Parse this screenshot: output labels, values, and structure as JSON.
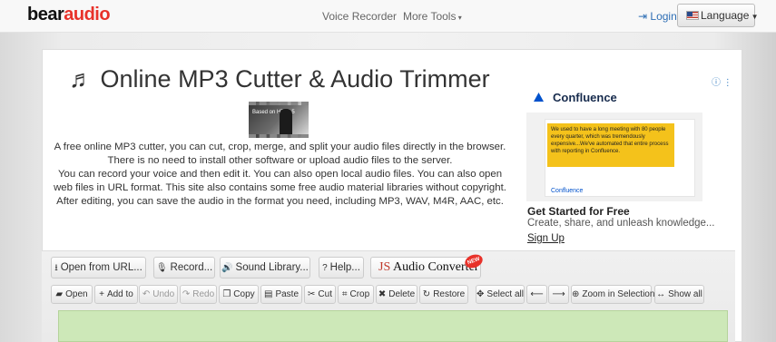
{
  "nav": {
    "logo_bear": "bear",
    "logo_audio": "audio",
    "voice_recorder": "Voice Recorder",
    "more_tools": "More Tools",
    "login": "Login",
    "language": "Language"
  },
  "main": {
    "title": "Online MP3 Cutter & Audio Trimmer",
    "thumbnail_text": "Based on HTML5",
    "description_1": "A free online MP3 cutter, you can cut, crop, merge, and split your audio files directly in the browser. There is no need to install other software or upload audio files to the server.",
    "description_2": "You can record your voice and then edit it. You can also open local audio files. You can also open web files in URL format. This site also contains some free audio material libraries without copyright. After editing, you can save the audio in the format you need, including MP3, WAV, M4R, AAC, etc."
  },
  "ad": {
    "info_label": "i",
    "brand": "Confluence",
    "quote": "We used to have a long meeting with 80 people every quarter, which was tremendously expensive...We've automated that entire process with reporting in Confluence.",
    "card_brand": "Confluence",
    "headline": "Get Started for Free",
    "body": "Create, share, and unleash knowledge...",
    "cta": "Sign Up"
  },
  "toolbar_top": {
    "open_url": "Open from URL...",
    "record": "Record...",
    "sound_library": "Sound Library...",
    "help": "Help...",
    "js_prefix": "JS",
    "js_label": "Audio Converter",
    "new_badge": "NEW"
  },
  "toolbar_edit": {
    "open": "Open",
    "add_to": "Add to",
    "undo": "Undo",
    "redo": "Redo",
    "copy": "Copy",
    "paste": "Paste",
    "cut": "Cut",
    "crop": "Crop",
    "delete": "Delete",
    "restore": "Restore",
    "select_all": "Select all",
    "zoom_in_selection": "Zoom in Selection",
    "show_all": "Show all"
  },
  "colors": {
    "brand_red": "#e8322a",
    "link_blue": "#2f6fb5",
    "waveform_bg": "#cde8b8",
    "ad_yellow": "#f4c21b"
  }
}
